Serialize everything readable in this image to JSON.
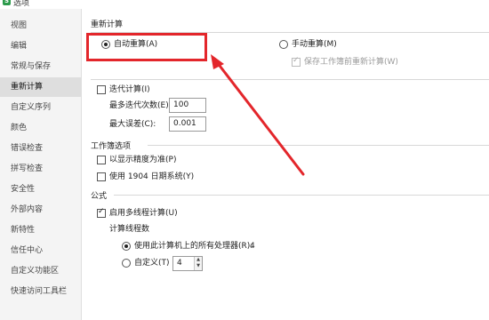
{
  "window": {
    "title": "选项",
    "app_icon_glyph": "S"
  },
  "sidebar": {
    "items": [
      {
        "label": "视图"
      },
      {
        "label": "编辑"
      },
      {
        "label": "常规与保存"
      },
      {
        "label": "重新计算"
      },
      {
        "label": "自定义序列"
      },
      {
        "label": "颜色"
      },
      {
        "label": "错误检查"
      },
      {
        "label": "拼写检查"
      },
      {
        "label": "安全性"
      },
      {
        "label": "外部内容"
      },
      {
        "label": "新特性"
      },
      {
        "label": "信任中心"
      },
      {
        "label": "自定义功能区"
      },
      {
        "label": "快速访问工具栏"
      }
    ],
    "active_index": 3
  },
  "recalc": {
    "section_title": "重新计算",
    "auto_label": "自动重算(A)",
    "auto_checked": true,
    "manual_label": "手动重算(M)",
    "manual_checked": false,
    "save_before_label": "保存工作簿前重新计算(W)",
    "save_before_checked": true,
    "save_before_disabled": true,
    "iter_label": "迭代计算(I)",
    "iter_checked": false,
    "max_iter_label": "最多迭代次数(E):",
    "max_iter_value": "100",
    "max_change_label": "最大误差(C):",
    "max_change_value": "0.001"
  },
  "workbook": {
    "section_title": "工作簿选项",
    "precision_label": "以显示精度为准(P)",
    "precision_checked": false,
    "date1904_label": "使用 1904 日期系统(Y)",
    "date1904_checked": false
  },
  "formula": {
    "section_title": "公式",
    "multithread_label": "启用多线程计算(U)",
    "multithread_checked": true,
    "threads_title": "计算线程数",
    "use_all_label": "使用此计算机上的所有处理器(R):",
    "use_all_value": "4",
    "use_all_checked": true,
    "custom_label": "自定义(T)",
    "custom_value": "4",
    "custom_checked": false
  },
  "colors": {
    "highlight": "#e3262b",
    "active_sidebar_bg": "#dedede"
  }
}
